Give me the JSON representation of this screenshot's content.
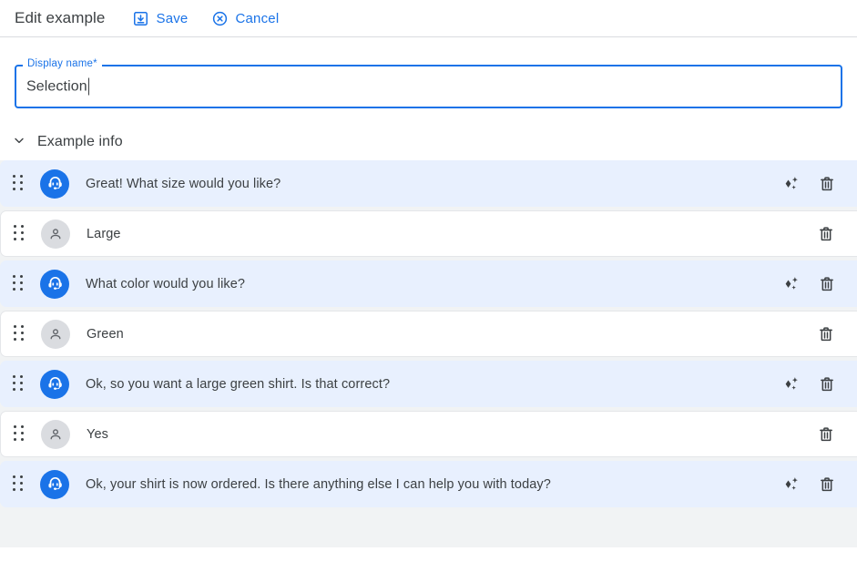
{
  "header": {
    "title": "Edit example",
    "save_label": "Save",
    "save_icon": "save-icon",
    "cancel_label": "Cancel",
    "cancel_icon": "cancel-circle-icon"
  },
  "form": {
    "display_name": {
      "label": "Display name*",
      "value": "Selection",
      "placeholder": "Display name"
    }
  },
  "section": {
    "title": "Example info",
    "expand_icon": "chevron-down-icon",
    "expanded": true
  },
  "colors": {
    "accent": "#1a73e8",
    "agent_row_bg": "#e8f0fe",
    "user_row_bg": "#ffffff",
    "page_bg": "#f1f3f4",
    "text": "#3c4043",
    "border": "#dadce0"
  },
  "rows": [
    {
      "speaker": "agent",
      "avatar_icon": "support-agent-icon",
      "text": "Great! What size would you like?",
      "actions": [
        "sparkle-icon",
        "delete-icon"
      ]
    },
    {
      "speaker": "user",
      "avatar_icon": "person-icon",
      "text": "Large",
      "actions": [
        "delete-icon"
      ]
    },
    {
      "speaker": "agent",
      "avatar_icon": "support-agent-icon",
      "text": "What color would you like?",
      "actions": [
        "sparkle-icon",
        "delete-icon"
      ]
    },
    {
      "speaker": "user",
      "avatar_icon": "person-icon",
      "text": "Green",
      "actions": [
        "delete-icon"
      ]
    },
    {
      "speaker": "agent",
      "avatar_icon": "support-agent-icon",
      "text": "Ok, so you want a large green shirt. Is that correct?",
      "actions": [
        "sparkle-icon",
        "delete-icon"
      ]
    },
    {
      "speaker": "user",
      "avatar_icon": "person-icon",
      "text": "Yes",
      "actions": [
        "delete-icon"
      ]
    },
    {
      "speaker": "agent",
      "avatar_icon": "support-agent-icon",
      "text": "Ok, your shirt is now ordered. Is there anything else I can help you with today?",
      "actions": [
        "sparkle-icon",
        "delete-icon"
      ]
    }
  ]
}
